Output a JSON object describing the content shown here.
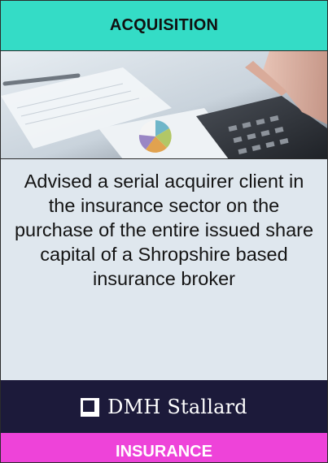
{
  "card": {
    "category": "ACQUISITION",
    "description": "Advised a serial acquirer client in the insurance sector on the purchase of the entire issued share capital of a Shropshire based insurance broker",
    "brand": {
      "name": "DMH Stallard",
      "logo_icon": "square-logo-icon"
    },
    "sector": "INSURANCE"
  },
  "colors": {
    "category_banner": "#34dcc6",
    "description_panel": "#dfe7ee",
    "brand_bar": "#1c1a3a",
    "sector_banner": "#ee43d9"
  },
  "hero_image": {
    "icon": "calculator-paperwork-photo"
  }
}
